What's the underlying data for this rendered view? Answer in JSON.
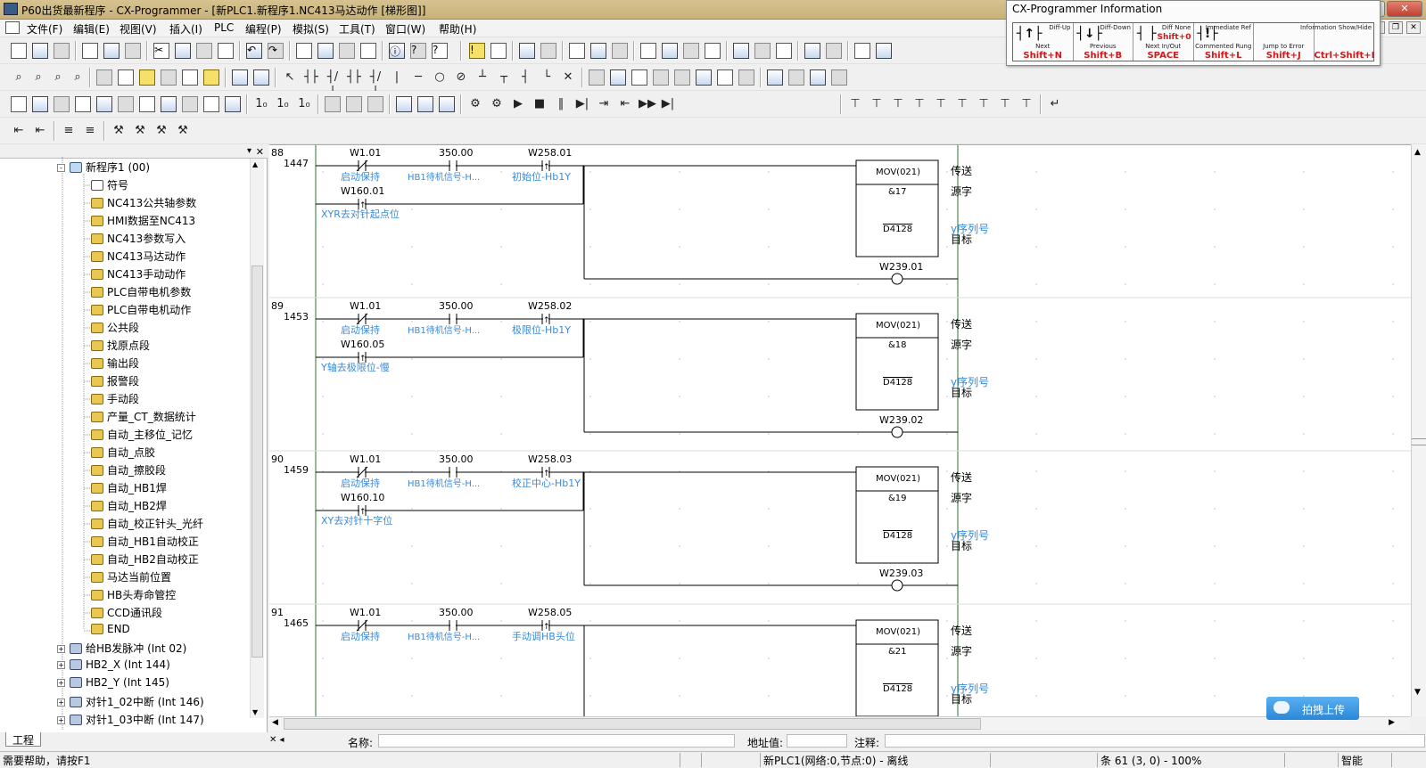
{
  "window": {
    "title": "P60出货最新程序 - CX-Programmer - [新PLC1.新程序1.NC413马达动作 [梯形图]]"
  },
  "menu": [
    "文件(F)",
    "编辑(E)",
    "视图(V)",
    "插入(I)",
    "PLC",
    "编程(P)",
    "模拟(S)",
    "工具(T)",
    "窗口(W)",
    "帮助(H)"
  ],
  "info_panel": {
    "title": "CX-Programmer Information",
    "cells": [
      {
        "top": "Diff-Up",
        "sym": "┤↑├",
        "bottom": "Next",
        "key": "Shift+N"
      },
      {
        "top": "Diff-Down",
        "sym": "┤↓├",
        "bottom": "Previous",
        "key": "Shift+B"
      },
      {
        "top": "Diff None",
        "sym": "┤ ├",
        "bottom": "Next In/Out",
        "key": "SPACE"
      },
      {
        "top": "Immediate Ref",
        "sym": "┤!├",
        "bottom": "Commented Rung",
        "key": "Shift+L"
      },
      {
        "top": "",
        "sym": "",
        "bottom": "Jump to Error",
        "key": "Shift+J"
      },
      {
        "top": "Information Show/Hide",
        "sym": "",
        "bottom": "",
        "key": "Ctrl+Shift+I"
      }
    ],
    "extra_keys": [
      "Shift+0"
    ]
  },
  "tree": {
    "program": "新程序1 (00)",
    "sections": [
      "符号",
      "NC413公共轴参数",
      "HMI数据至NC413",
      "NC413参数写入",
      "NC413马达动作",
      "NC413手动动作",
      "PLC自带电机参数",
      "PLC自带电机动作",
      "公共段",
      "找原点段",
      "输出段",
      "报警段",
      "手动段",
      "产量_CT_数据统计",
      "自动_主移位_记忆",
      "自动_点胶",
      "自动_擦胶段",
      "自动_HB1焊",
      "自动_HB2焊",
      "自动_校正针头_光纤",
      "自动_HB1自动校正",
      "自动_HB2自动校正",
      "马达当前位置",
      "HB头寿命管控",
      "CCD通讯段",
      "END"
    ],
    "interrupts": [
      "给HB发脉冲 (Int 02)",
      "HB2_X (Int 144)",
      "HB2_Y (Int 145)",
      "对针1_02中断 (Int 146)",
      "对针1_03中断 (Int 147)"
    ],
    "tab": "工程"
  },
  "ladder": {
    "rungs": [
      {
        "num": "88",
        "step": "1447",
        "c1": {
          "addr": "W1.01",
          "comment": "启动保持"
        },
        "c2": {
          "addr": "350.00",
          "comment": "HB1待机信号-H..."
        },
        "c3": {
          "addr": "W258.01",
          "comment": "初始位-Hb1Y"
        },
        "c4": {
          "addr": "W160.01",
          "comment": "XYR去对针起点位"
        },
        "instr": "MOV(021)",
        "src": "&17",
        "dst": "D4128",
        "out": "W239.01"
      },
      {
        "num": "89",
        "step": "1453",
        "c1": {
          "addr": "W1.01",
          "comment": "启动保持"
        },
        "c2": {
          "addr": "350.00",
          "comment": "HB1待机信号-H..."
        },
        "c3": {
          "addr": "W258.02",
          "comment": "极限位-Hb1Y"
        },
        "c4": {
          "addr": "W160.05",
          "comment": "Y轴去极限位-慢"
        },
        "instr": "MOV(021)",
        "src": "&18",
        "dst": "D4128",
        "out": "W239.02"
      },
      {
        "num": "90",
        "step": "1459",
        "c1": {
          "addr": "W1.01",
          "comment": "启动保持"
        },
        "c2": {
          "addr": "350.00",
          "comment": "HB1待机信号-H..."
        },
        "c3": {
          "addr": "W258.03",
          "comment": "校正中心-Hb1Y"
        },
        "c4": {
          "addr": "W160.10",
          "comment": "XY去对针十字位"
        },
        "instr": "MOV(021)",
        "src": "&19",
        "dst": "D4128",
        "out": "W239.03"
      },
      {
        "num": "91",
        "step": "1465",
        "c1": {
          "addr": "W1.01",
          "comment": "启动保持"
        },
        "c2": {
          "addr": "350.00",
          "comment": "HB1待机信号-H..."
        },
        "c3": {
          "addr": "W258.05",
          "comment": "手动调HB头位"
        },
        "c4": null,
        "instr": "MOV(021)",
        "src": "&21",
        "dst": "D4128",
        "out": null
      }
    ],
    "side_labels": {
      "op": "传送",
      "src": "源字",
      "seq": "y序列号",
      "dst": "目标"
    }
  },
  "namebar": {
    "name_label": "名称:",
    "addr_label": "地址值:",
    "comment_label": "注释:"
  },
  "status": {
    "help": "需要帮助，请按F1",
    "plc": "新PLC1(网络:0,节点:0) - 离线",
    "rung": "条 61 (3, 0)  - 100%",
    "mode": "智能"
  },
  "upload": {
    "label": "拍拽上传"
  },
  "colors": {
    "comment": "#3a8ad8",
    "title_bar": "#cdb884",
    "key": "#d01818"
  }
}
